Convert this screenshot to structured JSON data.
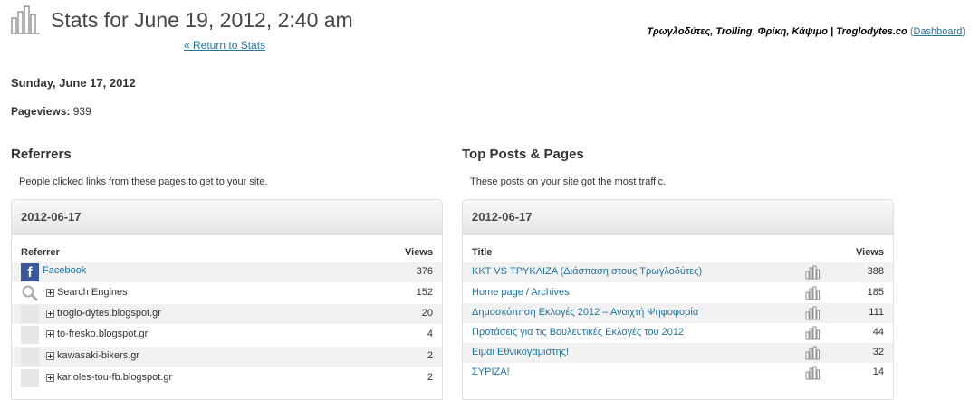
{
  "header": {
    "title": "Stats for June 19, 2012, 2:40 am",
    "return_link": "« Return to Stats",
    "site_name": "Τρωγλοδύτες, Trolling, Φρίκη, Κάψιμο | Troglodytes.co",
    "dashboard_link": "Dashboard"
  },
  "summary": {
    "day": "Sunday, June 17, 2012",
    "pageviews_label": "Pageviews:",
    "pageviews_value": "939"
  },
  "referrers": {
    "title": "Referrers",
    "description": "People clicked links from these pages to get to your site.",
    "date": "2012-06-17",
    "col_referrer": "Referrer",
    "col_views": "Views",
    "rows": [
      {
        "label": "Facebook",
        "views": "376",
        "icon": "facebook-icon",
        "link": true
      },
      {
        "label": "Search Engines",
        "views": "152",
        "icon": "magnifier-icon",
        "expandable": true
      },
      {
        "label": "troglo-dytes.blogspot.gr",
        "views": "20",
        "expandable": true
      },
      {
        "label": "to-fresko.blogspot.gr",
        "views": "4",
        "expandable": true
      },
      {
        "label": "kawasaki-bikers.gr",
        "views": "2",
        "expandable": true
      },
      {
        "label": "karioles-tou-fb.blogspot.gr",
        "views": "2",
        "expandable": true
      }
    ]
  },
  "top_posts": {
    "title": "Top Posts & Pages",
    "description": "These posts on your site got the most traffic.",
    "date": "2012-06-17",
    "col_title": "Title",
    "col_views": "Views",
    "rows": [
      {
        "label": "ΚΚΤ VS ΤΡΥΚΛΙΖΑ (Διάσπαση στους Τρωγλοδύτες)",
        "views": "388"
      },
      {
        "label": "Home page / Archives",
        "views": "185"
      },
      {
        "label": "Δημοσκόπηση Εκλογές 2012 – Ανοιχτή Ψηφοφορία",
        "views": "111"
      },
      {
        "label": "Προτάσεις για τις Βουλευτικές Εκλογές του 2012",
        "views": "44"
      },
      {
        "label": "Ειμαι Εθνικογαμιστης!",
        "views": "32"
      },
      {
        "label": "ΣΥΡΙΖΑ!",
        "views": "14"
      }
    ]
  }
}
